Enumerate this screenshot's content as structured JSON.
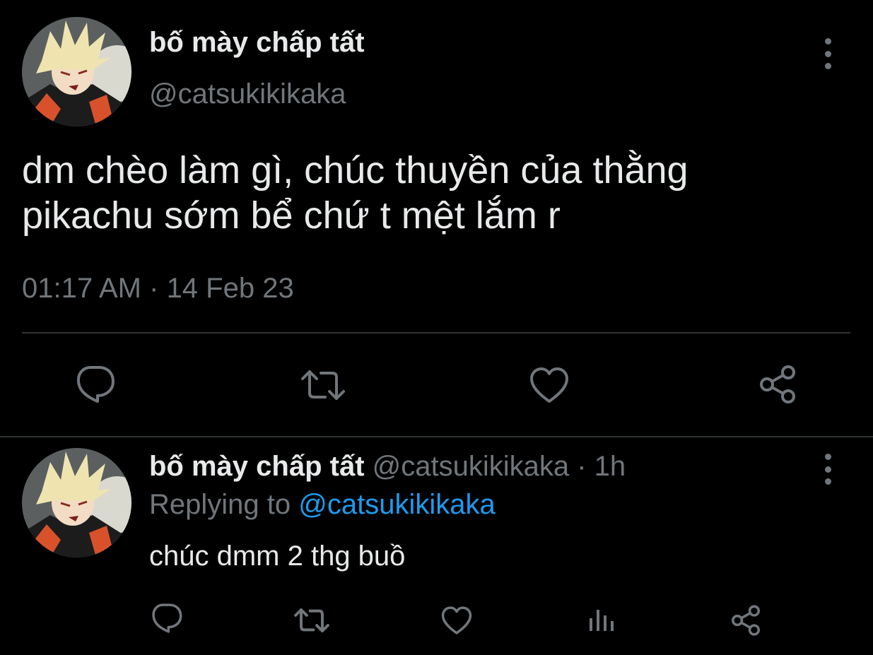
{
  "main_tweet": {
    "display_name": "bố mày chấp tất",
    "handle": "@catsukikikaka",
    "text_line1": "dm chèo làm gì, chúc thuyền của thằng",
    "text_line2": "pikachu sớm bể chứ t mệt lắm r",
    "time": "01:17 AM",
    "separator": " · ",
    "date": "14 Feb 23"
  },
  "reply_tweet": {
    "display_name": "bố mày chấp tất",
    "handle": "@catsukikikaka",
    "age": "1h",
    "replying_prefix": "Replying to ",
    "replying_to": "@catsukikikaka",
    "text": "chúc dmm 2 thg buồ"
  },
  "icons": {
    "more": "more-vertical-icon",
    "reply": "reply-icon",
    "retweet": "retweet-icon",
    "like": "like-icon",
    "share": "share-icon",
    "analytics": "analytics-icon"
  },
  "colors": {
    "background": "#000000",
    "text_primary": "#e7e9ea",
    "text_secondary": "#71767b",
    "accent": "#1d9bf0",
    "divider": "#2f3336"
  }
}
